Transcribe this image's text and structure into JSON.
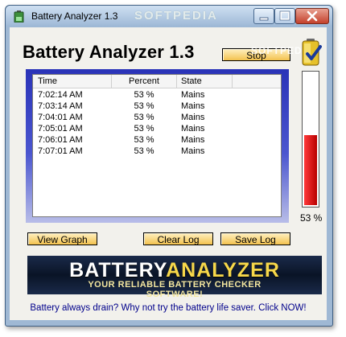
{
  "window": {
    "title": "Battery Analyzer 1.3",
    "watermark": "SOFTPEDIA"
  },
  "app": {
    "title": "Battery Analyzer 1.3",
    "stop_label": "Stop",
    "stop_watermark": "SOFTPEDIA"
  },
  "log": {
    "columns": {
      "time": "Time",
      "percent": "Percent",
      "state": "State"
    },
    "rows": [
      {
        "time": "7:02:14 AM",
        "percent": "53 %",
        "state": "Mains"
      },
      {
        "time": "7:03:14 AM",
        "percent": "53 %",
        "state": "Mains"
      },
      {
        "time": "7:04:01 AM",
        "percent": "53 %",
        "state": "Mains"
      },
      {
        "time": "7:05:01 AM",
        "percent": "53 %",
        "state": "Mains"
      },
      {
        "time": "7:06:01 AM",
        "percent": "53 %",
        "state": "Mains"
      },
      {
        "time": "7:07:01 AM",
        "percent": "53 %",
        "state": "Mains"
      }
    ]
  },
  "battery": {
    "level_percent": 53,
    "level_label": "53 %",
    "fill_color": "#d40000"
  },
  "buttons": {
    "view_graph": "View Graph",
    "clear_log": "Clear Log",
    "save_log": "Save Log"
  },
  "banner": {
    "title_part1": "BATTERY",
    "title_part2": "ANALYZER",
    "subtitle": "YOUR RELIABLE BATTERY CHECKER SOFTWARE!"
  },
  "footer": {
    "link_text": "Battery always drain? Why not try the battery life saver. Click NOW!"
  },
  "icons": {
    "app": "battery-app-icon",
    "battery_check": "battery-check-icon"
  }
}
